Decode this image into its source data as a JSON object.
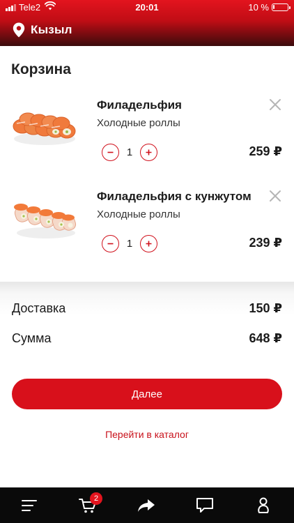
{
  "status_bar": {
    "carrier": "Tele2",
    "time": "20:01",
    "battery": "10 %",
    "battery_level": 0.1
  },
  "header": {
    "city": "Кызыл"
  },
  "page": {
    "title": "Корзина"
  },
  "cart": {
    "items": [
      {
        "name": "Филадельфия",
        "category": "Холодные роллы",
        "quantity": "1",
        "price": "259 ₽"
      },
      {
        "name": "Филадельфия с кунжутом",
        "category": "Холодные роллы",
        "quantity": "1",
        "price": "239 ₽"
      }
    ]
  },
  "summary": {
    "delivery_label": "Доставка",
    "delivery_value": "150 ₽",
    "total_label": "Сумма",
    "total_value": "648 ₽"
  },
  "actions": {
    "next_label": "Далее",
    "catalog_label": "Перейти в каталог"
  },
  "tabbar": {
    "cart_badge": "2",
    "icons": [
      "menu-icon",
      "cart-icon",
      "share-icon",
      "chat-icon",
      "profile-icon"
    ]
  },
  "colors": {
    "accent": "#d8101b",
    "header_top": "#e3141e",
    "header_bottom": "#3a0b0c",
    "tabbar": "#0a0a0a"
  }
}
